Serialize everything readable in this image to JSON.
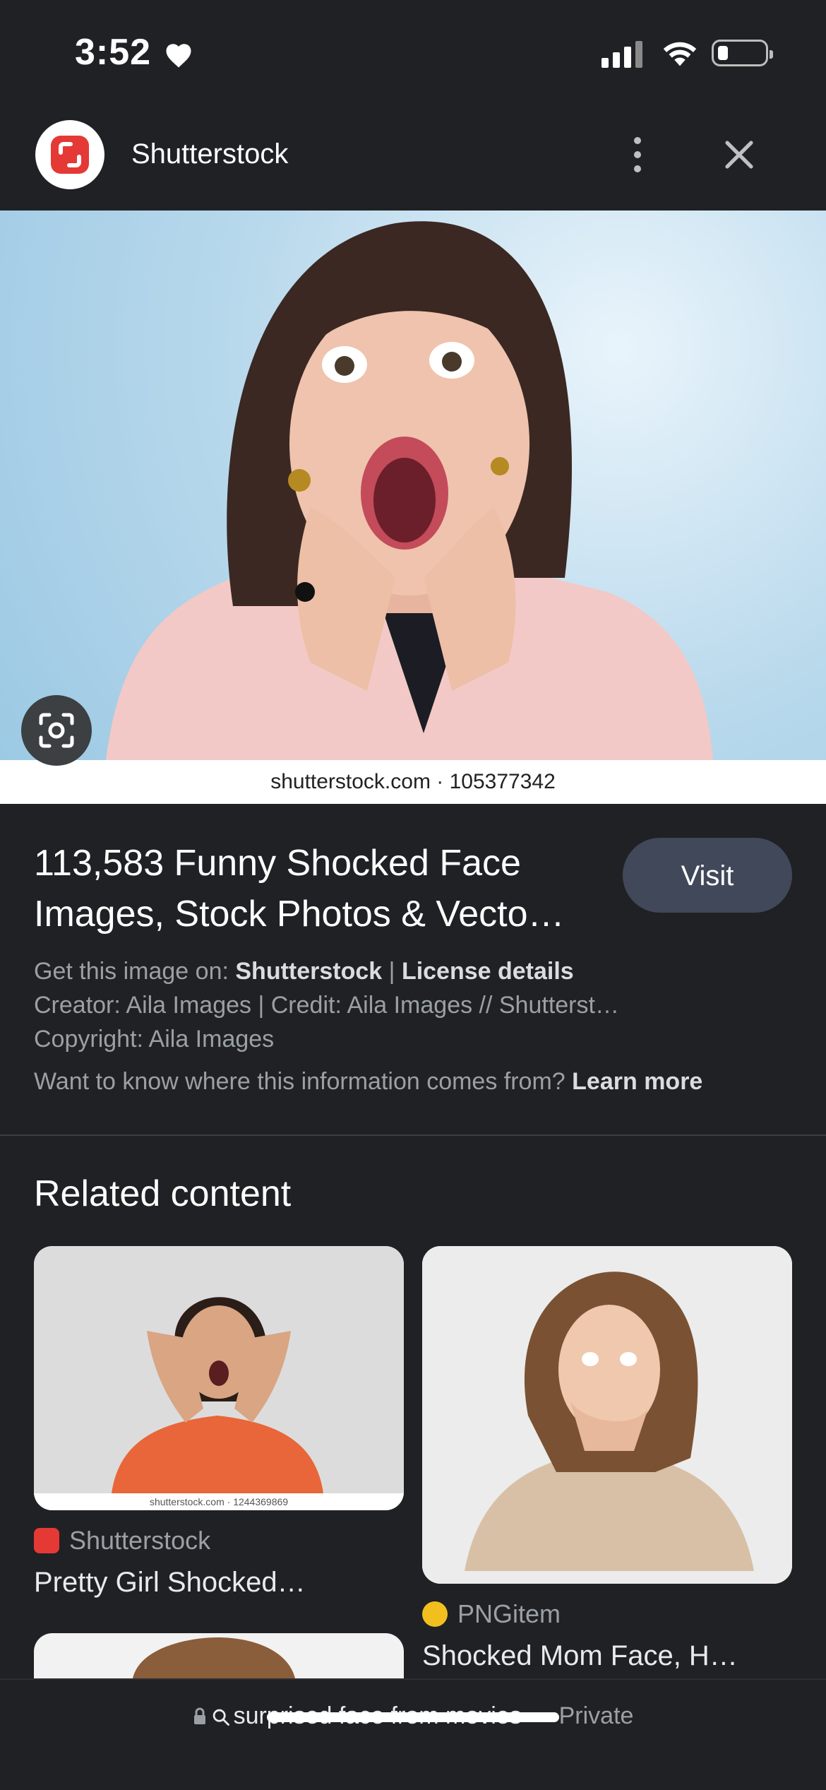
{
  "status": {
    "time": "3:52"
  },
  "header": {
    "site_name": "Shutterstock"
  },
  "image": {
    "watermark": "shutterstock.com · 105377342"
  },
  "result": {
    "title_line1": "113,583 Funny Shocked Face",
    "title_line2": "Images, Stock Photos & Vecto…",
    "visit_label": "Visit",
    "get_image_prefix": "Get this image on: ",
    "get_image_source": "Shutterstock",
    "separator": " | ",
    "license_label": "License details",
    "creator": "Creator: Aila Images | Credit: Aila Images // Shutterst…",
    "copyright": "Copyright: Aila Images",
    "info_question": "Want to know where this information comes from? ",
    "learn_more": "Learn more"
  },
  "related": {
    "heading": "Related content",
    "items": [
      {
        "source": "Shutterstock",
        "title": "Pretty Girl Shocked…",
        "watermark": "shutterstock.com · 1244369869"
      },
      {
        "source": "PNGitem",
        "title": "Shocked Mom Face, H…"
      }
    ]
  },
  "bottom": {
    "query": "surprised face from movies",
    "private_label": "— Private"
  },
  "colors": {
    "background": "#202124",
    "visit_button": "#404859",
    "shutterstock_red": "#e53935",
    "pngitem_yellow": "#f2c01e"
  }
}
